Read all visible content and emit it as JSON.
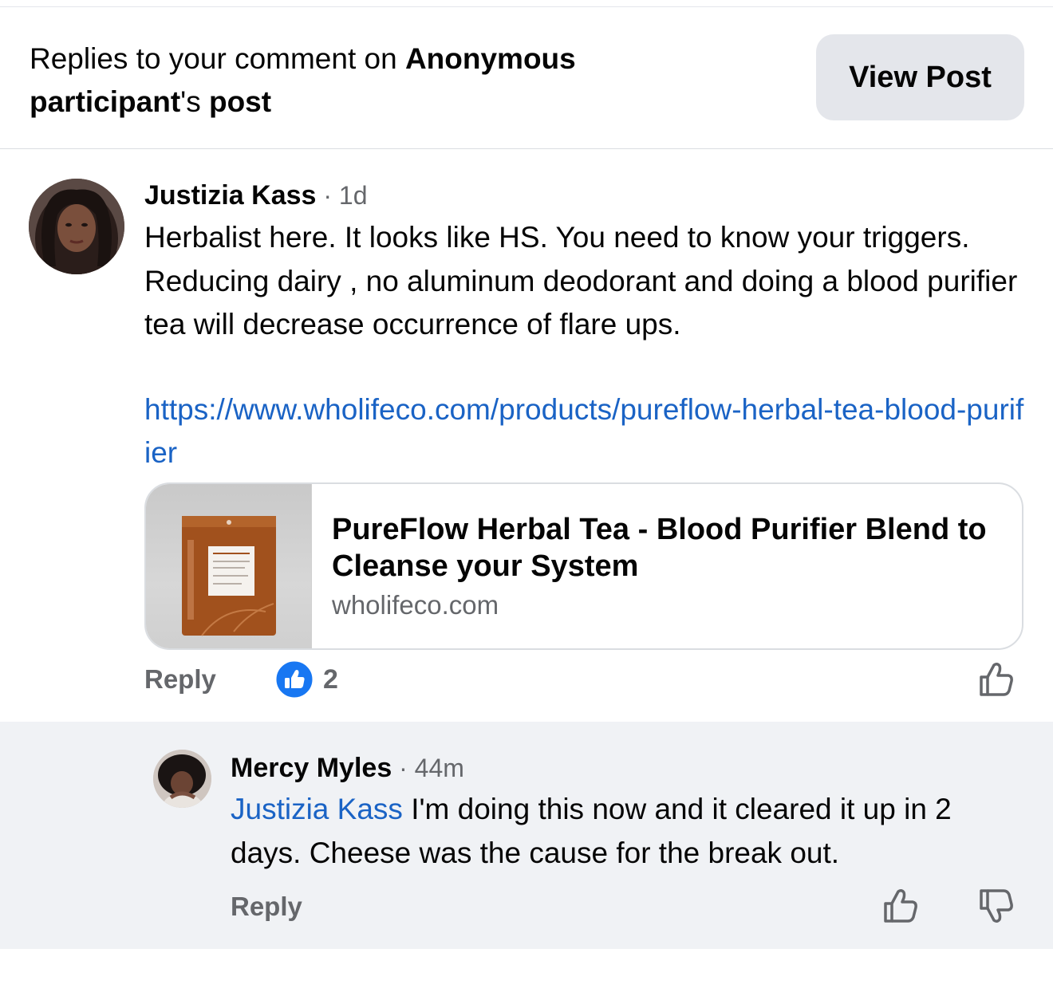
{
  "header": {
    "prefix": "Replies to your comment on ",
    "author": "Anonymous participant",
    "possessive": "'s ",
    "post_word": "post",
    "view_post_label": "View Post"
  },
  "comment": {
    "author": "Justizia Kass",
    "time": "1d",
    "text": "Herbalist here. It looks like HS. You need to know your triggers. Reducing dairy , no aluminum deodorant and doing a blood purifier tea will decrease occurrence of flare ups.",
    "link": "https://www.wholifeco.com/products/pureflow-herbal-tea-blood-purifier",
    "preview": {
      "title": "PureFlow Herbal Tea - Blood Purifier Blend to Cleanse your System",
      "domain": "wholifeco.com",
      "image_icon": "product-tea-pouch"
    },
    "reply_label": "Reply",
    "reaction_count": "2",
    "reaction_icon": "like-reaction-icon",
    "like_icon": "thumbs-up-icon"
  },
  "reply": {
    "author": "Mercy Myles",
    "time": "44m",
    "mention": "Justizia Kass",
    "text": " I'm doing this now and it cleared it up in 2 days. Cheese was the cause for the break out.",
    "reply_label": "Reply",
    "like_icon": "thumbs-up-icon",
    "dislike_icon": "thumbs-down-icon"
  },
  "colors": {
    "link": "#1a63c5",
    "secondary_text": "#65676b",
    "reaction_blue": "#1877f2",
    "reply_bg": "#f0f2f5",
    "button_bg": "#e4e6eb"
  }
}
